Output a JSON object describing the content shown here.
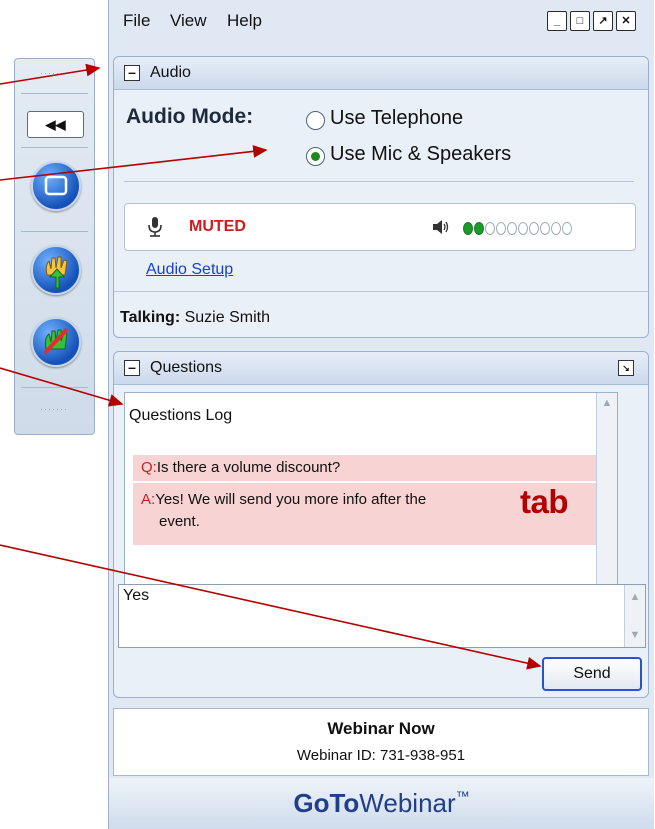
{
  "menu": {
    "file": "File",
    "view": "View",
    "help": "Help"
  },
  "window_buttons": {
    "minimize": "_",
    "restore": "□",
    "popout": "↗",
    "close": "✕"
  },
  "grab_tab": {
    "collapse_label": "◀◀"
  },
  "audio_panel": {
    "title": "Audio",
    "mode_label": "Audio Mode:",
    "options": [
      "Use Telephone",
      "Use Mic & Speakers"
    ],
    "selected_option": "Use Mic & Speakers",
    "status": "MUTED",
    "level_on_count": 2,
    "level_total": 10,
    "setup_link": "Audio Setup",
    "talking_label": "Talking:",
    "talking_name": "Suzie Smith"
  },
  "questions_panel": {
    "title": "Questions",
    "log_title": "Questions Log",
    "question_prefix": "Q:",
    "question": "Is there a volume discount?",
    "answer_prefix": "A:",
    "answer_line1": "Yes! We will send you more info after the",
    "answer_line2": "event.",
    "reply_value": "Yes",
    "send_label": "Send"
  },
  "session": {
    "name": "Webinar Now",
    "id_text": "Webinar ID: 731-938-951"
  },
  "brand": {
    "part1": "GoTo",
    "part2": "Webinar",
    "tm": "™"
  },
  "annotation": {
    "label": "tab"
  },
  "colors": {
    "annotation_red": "#b30000",
    "muted_red": "#d31a1a",
    "level_green": "#1d9a2e",
    "link_blue": "#1a3fcf",
    "qa_highlight": "#f7d3d3",
    "brand_blue": "#1f3f8a"
  }
}
